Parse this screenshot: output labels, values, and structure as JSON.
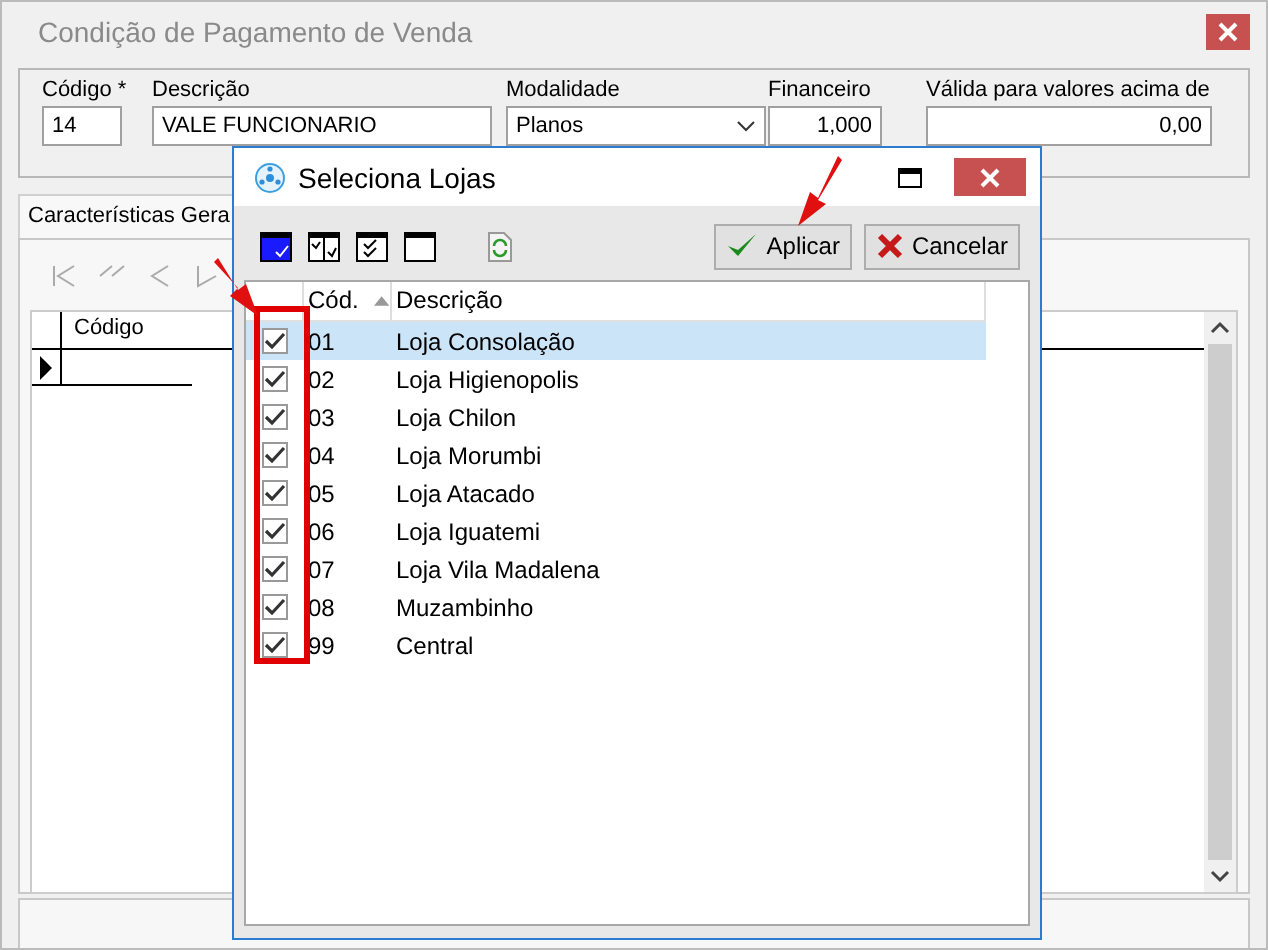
{
  "window": {
    "title": "Condição de Pagamento de Venda"
  },
  "header": {
    "fields": [
      {
        "label": "Código *",
        "value": "14",
        "kind": "text"
      },
      {
        "label": "Descrição",
        "value": "VALE FUNCIONARIO",
        "kind": "text"
      },
      {
        "label": "Modalidade",
        "value": "Planos",
        "kind": "dropdown"
      },
      {
        "label": "Financeiro",
        "value": "1,000",
        "kind": "number"
      },
      {
        "label": "Válida para valores acima de",
        "value": "0,00",
        "kind": "number"
      }
    ]
  },
  "tabs": [
    {
      "label": "Características Gera",
      "selected": true
    }
  ],
  "grid": {
    "columns": [
      "Código"
    ]
  },
  "dialog": {
    "title": "Seleciona Lojas",
    "buttons": [
      {
        "label": "Aplicar",
        "kind": "apply"
      },
      {
        "label": "Cancelar",
        "kind": "cancel"
      }
    ],
    "columns": [
      "Cód.",
      "Descrição"
    ],
    "rows": [
      {
        "code": "01",
        "name": "Loja Consolação",
        "checked": true,
        "selected": true
      },
      {
        "code": "02",
        "name": "Loja Higienopolis",
        "checked": true,
        "selected": false
      },
      {
        "code": "03",
        "name": "Loja Chilon",
        "checked": true,
        "selected": false
      },
      {
        "code": "04",
        "name": "Loja Morumbi",
        "checked": true,
        "selected": false
      },
      {
        "code": "05",
        "name": "Loja Atacado",
        "checked": true,
        "selected": false
      },
      {
        "code": "06",
        "name": "Loja Iguatemi",
        "checked": true,
        "selected": false
      },
      {
        "code": "07",
        "name": "Loja Vila Madalena",
        "checked": true,
        "selected": false
      },
      {
        "code": "08",
        "name": "Muzambinho",
        "checked": true,
        "selected": false
      },
      {
        "code": "99",
        "name": "Central",
        "checked": true,
        "selected": false
      }
    ]
  }
}
